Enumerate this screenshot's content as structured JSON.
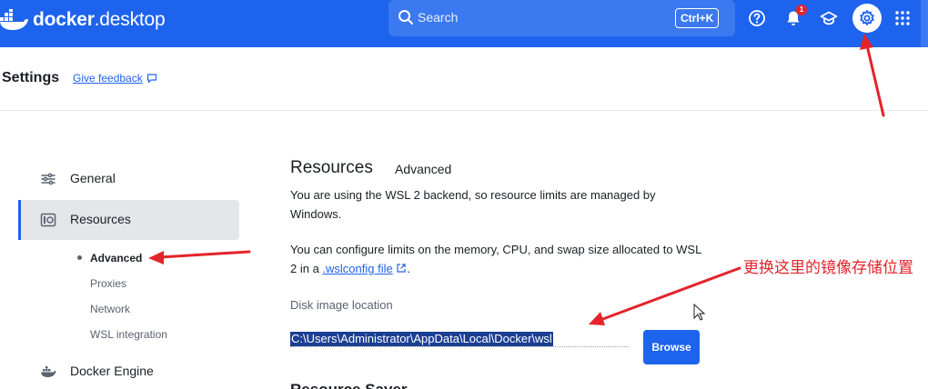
{
  "app": {
    "logo_word1": "docker",
    "logo_word2": ".desktop",
    "brand_color": "#1d63ed"
  },
  "header": {
    "search_placeholder": "Search",
    "search_shortcut": "Ctrl+K",
    "notification_count": "1",
    "icons": [
      "help-icon",
      "bell-icon",
      "learning-center-icon",
      "gear-icon",
      "apps-grid-icon"
    ]
  },
  "settings": {
    "title": "Settings",
    "feedback_label": "Give feedback"
  },
  "sidebar": {
    "items": [
      {
        "label": "General",
        "icon": "sliders-icon"
      },
      {
        "label": "Resources",
        "icon": "resources-icon",
        "active": true
      },
      {
        "label": "Docker Engine",
        "icon": "whale-icon"
      }
    ],
    "sub_items": [
      {
        "label": "Advanced",
        "active": true
      },
      {
        "label": "Proxies"
      },
      {
        "label": "Network"
      },
      {
        "label": "WSL integration"
      }
    ]
  },
  "main": {
    "heading": "Resources",
    "subheading": "Advanced",
    "paragraph1": "You are using the WSL 2 backend, so resource limits are managed by Windows.",
    "paragraph2_prefix": "You can configure limits on the memory, CPU, and swap size allocated to WSL 2 in a ",
    "paragraph2_link": ".wslconfig file",
    "paragraph2_suffix": ".",
    "disk_image_label": "Disk image location",
    "disk_image_path": "C:\\Users\\Administrator\\AppData\\Local\\Docker\\wsl",
    "browse_label": "Browse",
    "next_section_heading": "Resource Saver"
  },
  "annotation": {
    "text": "更换这里的镜像存储位置",
    "color": "#e3242b"
  }
}
